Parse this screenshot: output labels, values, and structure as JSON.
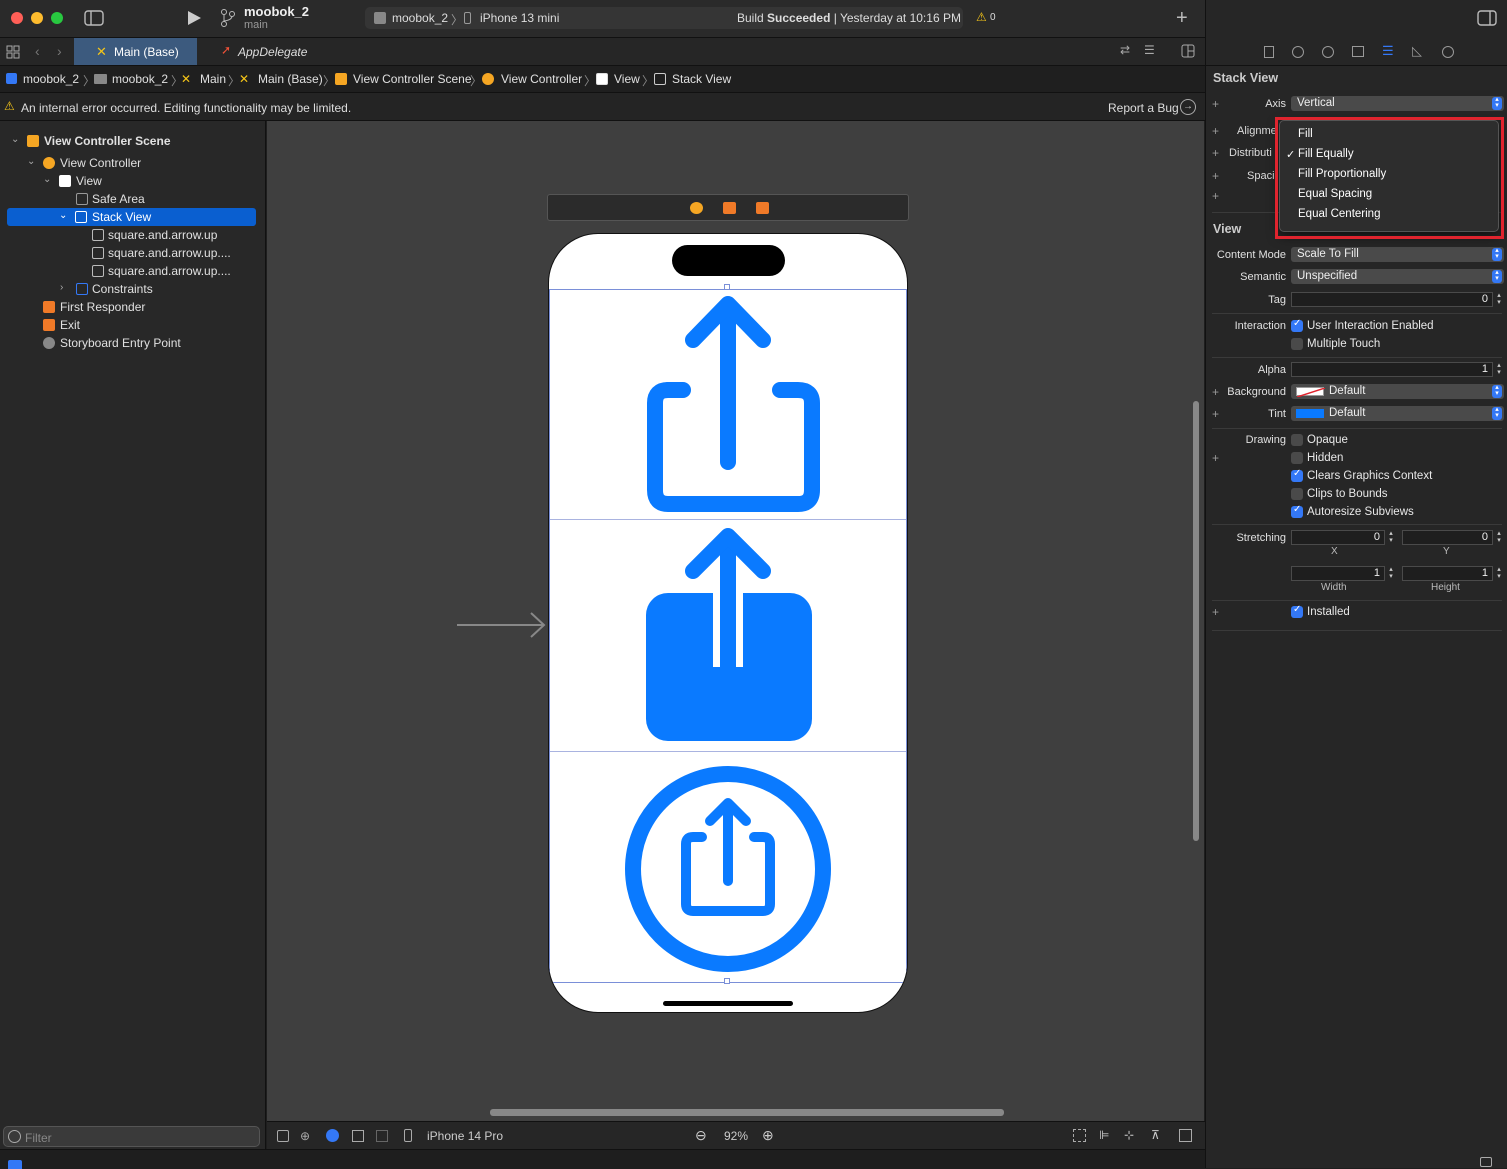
{
  "window": {
    "project": "moobok_2",
    "branch": "main",
    "scheme": "moobok_2",
    "device": "iPhone 13 mini",
    "build_status_prefix": "Build ",
    "build_status_bold": "Succeeded",
    "build_time": "| Yesterday at 10:16 PM",
    "warnings": "0"
  },
  "tabs": [
    {
      "label": "Main (Base)"
    },
    {
      "label": "AppDelegate"
    }
  ],
  "breadcrumb": [
    "moobok_2",
    "moobok_2",
    "Main",
    "Main (Base)",
    "View Controller Scene",
    "View Controller",
    "View",
    "Stack View"
  ],
  "warning": {
    "text": "An internal error occurred. Editing functionality may be limited.",
    "report": "Report a Bug"
  },
  "outline": [
    "View Controller Scene",
    "View Controller",
    "View",
    "Safe Area",
    "Stack View",
    "square.and.arrow.up",
    "square.and.arrow.up....",
    "square.and.arrow.up....",
    "Constraints",
    "First Responder",
    "Exit",
    "Storyboard Entry Point"
  ],
  "filter_placeholder": "Filter",
  "canvas": {
    "device": "iPhone 14 Pro",
    "zoom": "92%"
  },
  "inspector": {
    "stack_view_title": "Stack View",
    "axis_label": "Axis",
    "axis_value": "Vertical",
    "alignment_label": "Alignme",
    "distribution_label": "Distributi",
    "spacing_label": "Spaci",
    "distribution_menu": [
      "Fill",
      "Fill Equally",
      "Fill Proportionally",
      "Equal Spacing",
      "Equal Centering"
    ],
    "distribution_selected": "Fill Equally",
    "view_title": "View",
    "content_mode_label": "Content Mode",
    "content_mode": "Scale To Fill",
    "semantic_label": "Semantic",
    "semantic": "Unspecified",
    "tag_label": "Tag",
    "tag": "0",
    "interaction_label": "Interaction",
    "user_interaction": "User Interaction Enabled",
    "multiple_touch": "Multiple Touch",
    "alpha_label": "Alpha",
    "alpha": "1",
    "background_label": "Background",
    "background": "Default",
    "tint_label": "Tint",
    "tint": "Default",
    "drawing_label": "Drawing",
    "opaque": "Opaque",
    "hidden": "Hidden",
    "clears": "Clears Graphics Context",
    "clips": "Clips to Bounds",
    "autoresize": "Autoresize Subviews",
    "stretching_label": "Stretching",
    "stretch_x": "0",
    "stretch_y": "0",
    "stretch_w": "1",
    "stretch_h": "1",
    "x_label": "X",
    "y_label": "Y",
    "width_label": "Width",
    "height_label": "Height",
    "installed": "Installed",
    "accent": "#3478f6",
    "highlight": "#e0242e"
  }
}
